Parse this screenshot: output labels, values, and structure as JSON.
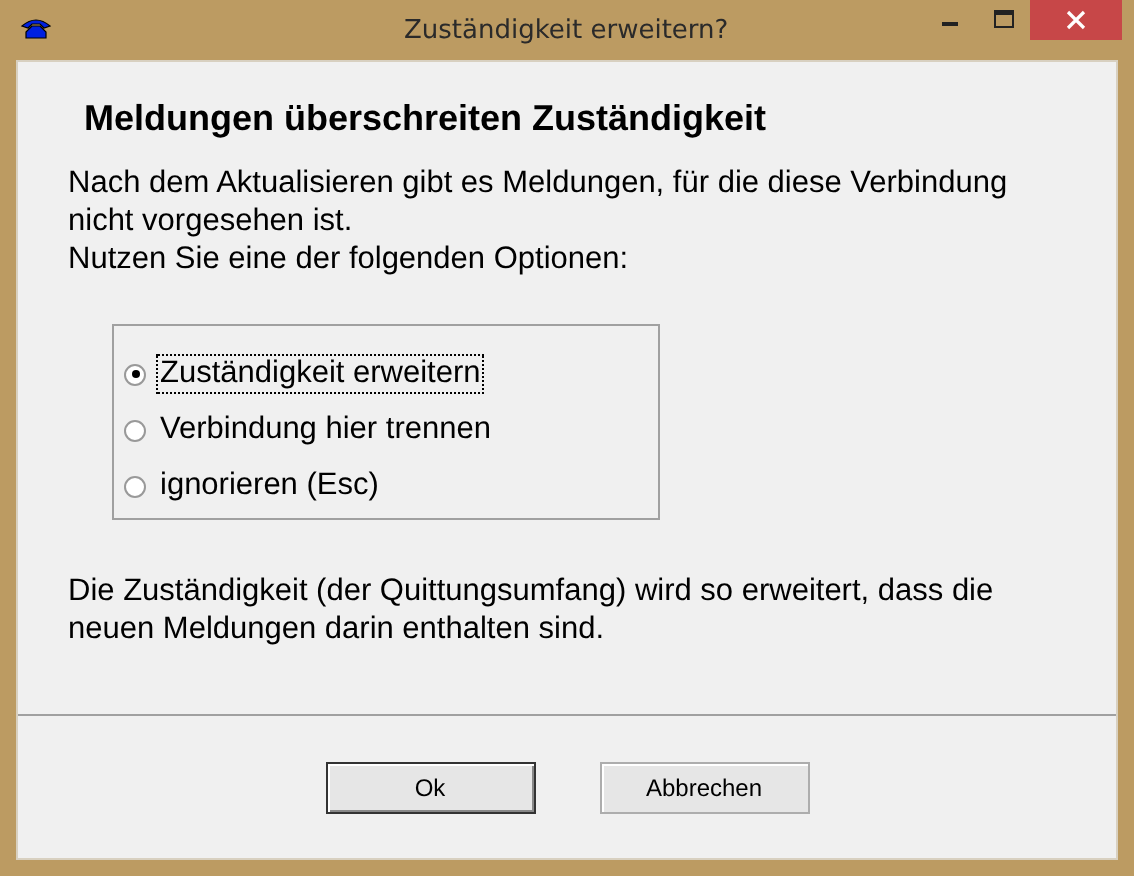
{
  "window": {
    "title": "Zuständigkeit erweitern?"
  },
  "heading": "Meldungen überschreiten Zuständigkeit",
  "intro": [
    "Nach dem Aktualisieren gibt es Meldungen, für die diese Verbindung nicht vorgesehen ist.",
    "Nutzen Sie eine der folgenden Optionen:"
  ],
  "options": [
    {
      "label": "Zuständigkeit erweitern",
      "selected": true
    },
    {
      "label": "Verbindung hier trennen",
      "selected": false
    },
    {
      "label": "ignorieren (Esc)",
      "selected": false
    }
  ],
  "note": "Die Zuständigkeit (der Quittungsumfang) wird so erweitert, dass die neuen Meldungen darin enthalten sind.",
  "buttons": [
    "Ok",
    "Abbrechen"
  ]
}
